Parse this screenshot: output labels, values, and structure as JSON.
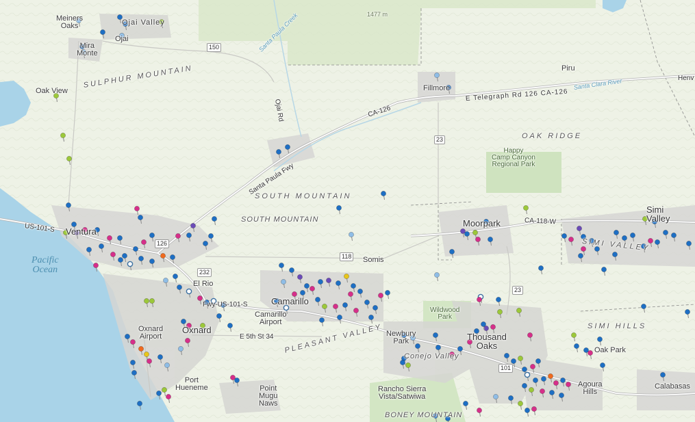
{
  "map": {
    "labels": {
      "meiners_oaks": "Meiners\nOaks",
      "ojai_valley": "Ojai Valley",
      "ojai": "Ojai",
      "mira_monte": "Mira\nMonte",
      "oak_view": "Oak View",
      "sulphur_mountain": "SULPHUR MOUNTAIN",
      "ojai_rd": "Ojai Rd",
      "santa_paula_creek": "Santa Paula Creek",
      "elev_1477": "1477 m",
      "fillmore": "Fillmore",
      "piru": "Piru",
      "telegraph_rd": "E Telegraph Rd 126 CA-126",
      "santa_clara_river": "Santa Clara River",
      "henv": "Henv",
      "ca_126": "CA-126",
      "oak_ridge": "OAK RIDGE",
      "happy_camp": "Happy\nCamp Canyon\nRegional Park",
      "santa_paula_fwy": "Santa Paula Fwy",
      "south_mountain_ridge": "SOUTH MOUNTAIN",
      "south_mountain": "SOUTH MOUNTAIN",
      "us_101": "US-101-S",
      "ventura": "Ventura",
      "pacific_ocean": "Pacific\nOcean",
      "somis": "Somis",
      "moorpark": "Moorpark",
      "ca_118": "CA-118-W",
      "simi_valley_city": "Simi\nValley",
      "simi_valley": "SIMI VALLEY",
      "el_rio": "El Rio",
      "fwy_us101": "Fwy-US-101-S",
      "camarillo": "Camarillo",
      "camarillo_airport": "Camarillo\nAirport",
      "oxnard_airport": "Oxnard\nAirport",
      "oxnard": "Oxnard",
      "e5th": "E 5th St 34",
      "pleasant_valley": "PLEASANT VALLEY",
      "newbury_park": "Newbury\nPark",
      "conejo_valley": "Conejo Valley",
      "wildwood_park": "Wildwood\nPark",
      "thousand_oaks": "Thousand\nOaks",
      "simi_hills": "SIMI HILLS",
      "oak_park": "Oak Park",
      "port_hueneme": "Port\nHueneme",
      "point_mugu": "Point\nMugu\nNaws",
      "rancho_sierra": "Rancho Sierra\nVista/Satwiwa",
      "boney_mountain": "BONEY MOUNTAIN",
      "agoura_hills": "Agoura\nHills",
      "calabasas": "Calabasas"
    },
    "shields": {
      "s150": "150",
      "s126": "126",
      "s23a": "23",
      "s23b": "23",
      "s118": "118",
      "s232": "232",
      "s101": "101"
    },
    "colors": {
      "land": "#eef2e6",
      "ocean": "#a9d3e8",
      "urban": "#d6d6d3",
      "park": "#cfe3bf",
      "road": "#ffffff",
      "pin_blue": "#1e6fc4",
      "pin_light": "#8fbde6",
      "pin_magenta": "#d62f8a",
      "pin_purple": "#6b4bb8",
      "pin_green": "#9cc83a",
      "pin_orange": "#f06a1e",
      "pin_yellow": "#e8c61a",
      "pin_white": "#ffffff"
    }
  }
}
